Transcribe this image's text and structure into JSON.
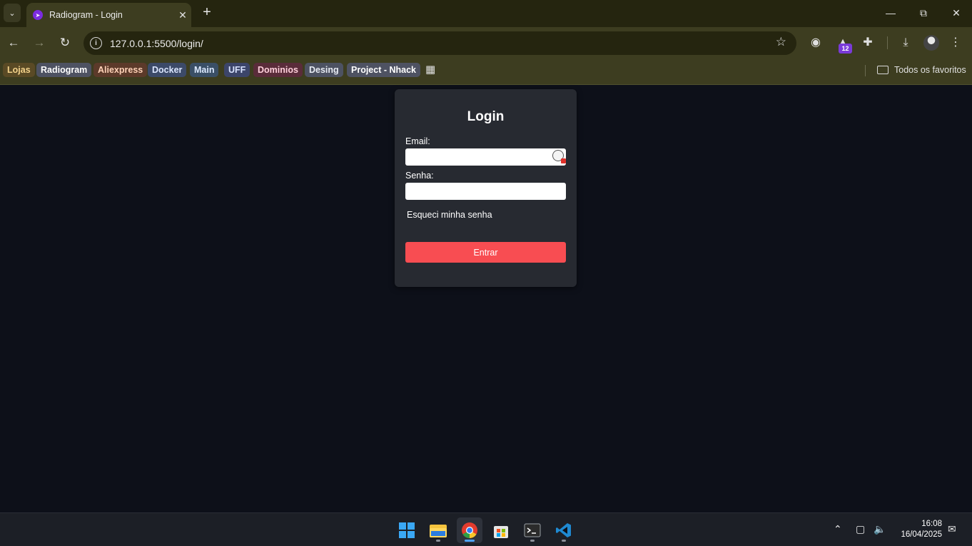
{
  "browser": {
    "tab": {
      "title": "Radiogram - Login"
    },
    "url": "127.0.0.1:5500/login/",
    "extension_badge": "12",
    "bookmarks": [
      {
        "label": "Lojas",
        "color": "#f3d28a",
        "bg": "#5a4a25"
      },
      {
        "label": "Radiogram",
        "color": "#ffffff",
        "bg": "#4e5262"
      },
      {
        "label": "Aliexpress",
        "color": "#ffd2b8",
        "bg": "#5c3a2a"
      },
      {
        "label": "Docker",
        "color": "#dbe6ff",
        "bg": "#3c4a68"
      },
      {
        "label": "Main",
        "color": "#dbe9ff",
        "bg": "#3a4f66"
      },
      {
        "label": "UFF",
        "color": "#d8e2ff",
        "bg": "#3c456a"
      },
      {
        "label": "Dominios",
        "color": "#ffd0dc",
        "bg": "#5a2c3a"
      },
      {
        "label": "Desing",
        "color": "#e8ecf4",
        "bg": "#4d5262"
      },
      {
        "label": "Project - Nhack",
        "color": "#ffffff",
        "bg": "#4e5262"
      }
    ],
    "all_favorites_label": "Todos os favoritos"
  },
  "login": {
    "title": "Login",
    "email_label": "Email:",
    "email_value": "",
    "password_label": "Senha:",
    "password_value": "",
    "forgot_link": "Esqueci minha senha",
    "submit_label": "Entrar",
    "button_color": "#f84d52"
  },
  "taskbar": {
    "apps": [
      "windows-start",
      "file-explorer",
      "chrome",
      "microsoft-store",
      "terminal",
      "vscode"
    ],
    "time": "16:08",
    "date": "16/04/2025"
  }
}
